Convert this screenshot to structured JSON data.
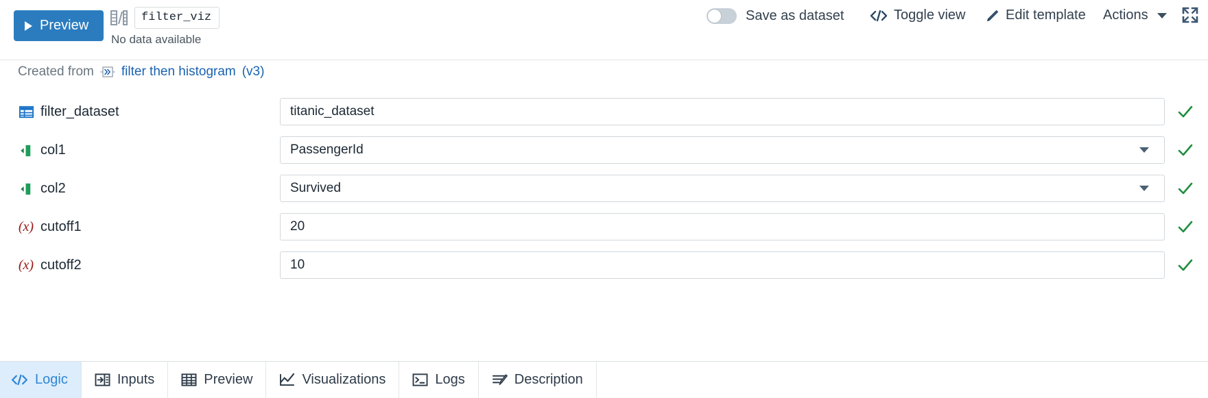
{
  "toolbar": {
    "preview_button": "Preview",
    "name_value": "filter_viz",
    "status_text": "No data available",
    "save_as_dataset_label": "Save as dataset",
    "save_as_dataset_state": "off",
    "toggle_view_label": "Toggle view",
    "edit_template_label": "Edit template",
    "actions_label": "Actions",
    "expand_icon": "expand-icon",
    "name_icon": "code-notebook-icon",
    "toggle_view_icon": "code-brackets-icon",
    "edit_template_icon": "pencil-icon",
    "actions_caret_icon": "chevron-down-icon"
  },
  "created_from": {
    "label": "Created from",
    "recipe_icon": "recipe-chevrons-icon",
    "recipe_name": "filter then histogram",
    "version": "(v3)"
  },
  "form": {
    "rows": [
      {
        "icon": "dataset-table-icon",
        "label": "filter_dataset",
        "control_type": "text",
        "value": "titanic_dataset",
        "valid": true,
        "check_icon": "check-icon"
      },
      {
        "icon": "column-icon",
        "label": "col1",
        "control_type": "select",
        "value": "PassengerId",
        "valid": true,
        "check_icon": "check-icon"
      },
      {
        "icon": "column-icon",
        "label": "col2",
        "control_type": "select",
        "value": "Survived",
        "valid": true,
        "check_icon": "check-icon"
      },
      {
        "icon": "variable-x-icon",
        "icon_text": "(x)",
        "label": "cutoff1",
        "control_type": "text",
        "value": "20",
        "valid": true,
        "check_icon": "check-icon"
      },
      {
        "icon": "variable-x-icon",
        "icon_text": "(x)",
        "label": "cutoff2",
        "control_type": "text",
        "value": "10",
        "valid": true,
        "check_icon": "check-icon"
      }
    ]
  },
  "tabs": [
    {
      "label": "Logic",
      "icon": "code-brackets-icon",
      "active": true
    },
    {
      "label": "Inputs",
      "icon": "input-arrow-icon",
      "active": false
    },
    {
      "label": "Preview",
      "icon": "table-grid-icon",
      "active": false
    },
    {
      "label": "Visualizations",
      "icon": "line-chart-icon",
      "active": false
    },
    {
      "label": "Logs",
      "icon": "terminal-icon",
      "active": false
    },
    {
      "label": "Description",
      "icon": "edit-lines-icon",
      "active": false
    }
  ],
  "colors": {
    "primary_blue": "#2b7cbf",
    "link_blue": "#1a62b0",
    "active_tab_bg": "#ddedfb",
    "active_tab_text": "#2f86d4",
    "valid_green": "#1e8e3e",
    "param_red": "#9c1616",
    "column_green": "#1e9e5a"
  }
}
